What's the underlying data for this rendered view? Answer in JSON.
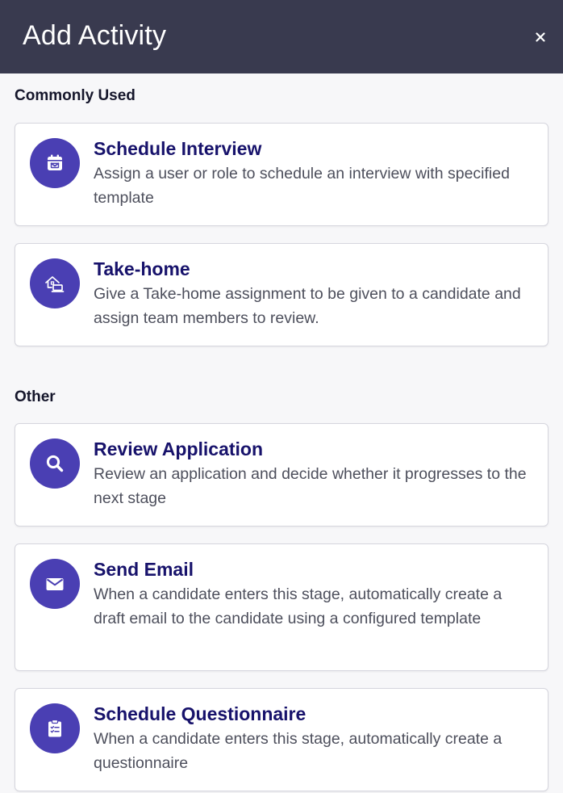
{
  "dialog": {
    "title": "Add Activity",
    "close_label": "×"
  },
  "sections": [
    {
      "title": "Commonly Used",
      "cards": [
        {
          "title": "Schedule Interview",
          "description": "Assign a user or role to schedule an interview with specified template",
          "icon": "calendar-icon"
        },
        {
          "title": "Take-home",
          "description": "Give a Take-home assignment to be given to a candidate and assign team members to review.",
          "icon": "take-home-icon"
        }
      ]
    },
    {
      "title": "Other",
      "cards": [
        {
          "title": "Review Application",
          "description": "Review an application and decide whether it progresses to the next stage",
          "icon": "search-icon"
        },
        {
          "title": "Send Email",
          "description": "When a candidate enters this stage, automatically create a draft email to the candidate using a configured template",
          "icon": "envelope-icon"
        },
        {
          "title": "Schedule Questionnaire",
          "description": "When a candidate enters this stage, automatically create a questionnaire",
          "icon": "clipboard-icon"
        }
      ]
    }
  ],
  "colors": {
    "header_bg": "#393a4f",
    "icon_bg": "#4a3fb3",
    "card_title": "#17126b"
  }
}
